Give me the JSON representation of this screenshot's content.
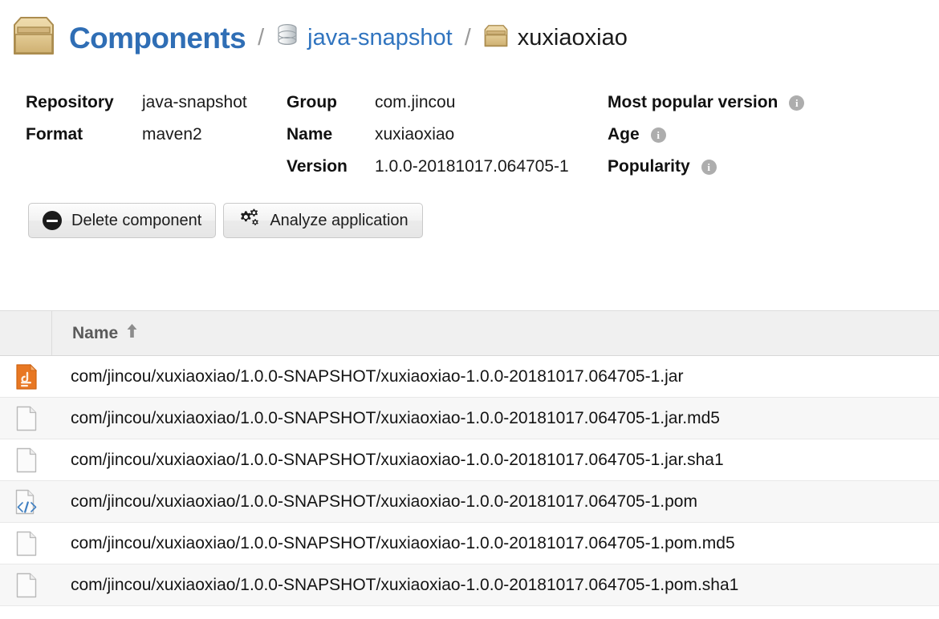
{
  "breadcrumb": {
    "root_icon": "package-box-icon",
    "root_label": "Components",
    "separator": "/",
    "repo_icon": "database-icon",
    "repo_label": "java-snapshot",
    "component_icon": "package-box-icon",
    "component_label": "xuxiaoxiao"
  },
  "details": {
    "repository_label": "Repository",
    "repository_value": "java-snapshot",
    "format_label": "Format",
    "format_value": "maven2",
    "group_label": "Group",
    "group_value": "com.jincou",
    "name_label": "Name",
    "name_value": "xuxiaoxiao",
    "version_label": "Version",
    "version_value": "1.0.0-20181017.064705-1",
    "most_popular_version_label": "Most popular version",
    "age_label": "Age",
    "popularity_label": "Popularity",
    "info_glyph": "i"
  },
  "toolbar": {
    "delete_label": "Delete component",
    "delete_icon": "minus-circle-icon",
    "analyze_label": "Analyze application",
    "analyze_icon": "gears-icon"
  },
  "table": {
    "column_name": "Name",
    "sort_direction_icon": "arrow-up-icon",
    "rows": [
      {
        "icon": "jar-file-icon",
        "name": "com/jincou/xuxiaoxiao/1.0.0-SNAPSHOT/xuxiaoxiao-1.0.0-20181017.064705-1.jar"
      },
      {
        "icon": "generic-file-icon",
        "name": "com/jincou/xuxiaoxiao/1.0.0-SNAPSHOT/xuxiaoxiao-1.0.0-20181017.064705-1.jar.md5"
      },
      {
        "icon": "generic-file-icon",
        "name": "com/jincou/xuxiaoxiao/1.0.0-SNAPSHOT/xuxiaoxiao-1.0.0-20181017.064705-1.jar.sha1"
      },
      {
        "icon": "xml-file-icon",
        "name": "com/jincou/xuxiaoxiao/1.0.0-SNAPSHOT/xuxiaoxiao-1.0.0-20181017.064705-1.pom"
      },
      {
        "icon": "generic-file-icon",
        "name": "com/jincou/xuxiaoxiao/1.0.0-SNAPSHOT/xuxiaoxiao-1.0.0-20181017.064705-1.pom.md5"
      },
      {
        "icon": "generic-file-icon",
        "name": "com/jincou/xuxiaoxiao/1.0.0-SNAPSHOT/xuxiaoxiao-1.0.0-20181017.064705-1.pom.sha1"
      }
    ]
  },
  "colors": {
    "link_blue": "#3074bf",
    "title_blue": "#2f6eb5",
    "jar_orange": "#e87722",
    "xml_blue": "#3f7fc1",
    "box_tan": "#d9b878",
    "header_gray": "#f0f0f0",
    "row_alt_gray": "#f7f7f7",
    "info_gray": "#adadad"
  }
}
